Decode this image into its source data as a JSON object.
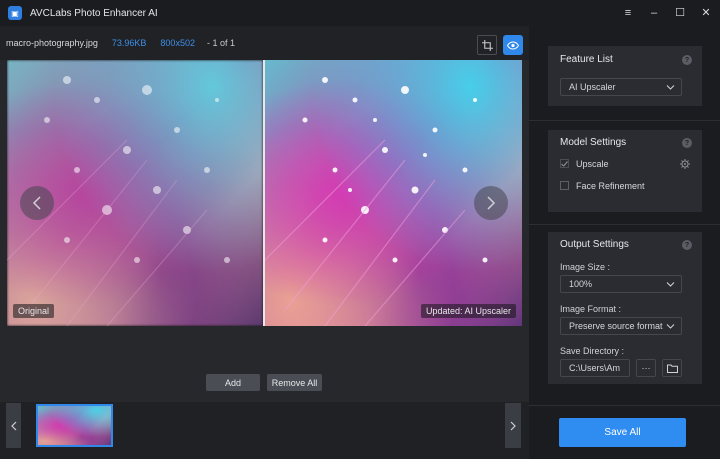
{
  "app": {
    "title": "AVCLabs Photo Enhancer AI"
  },
  "file": {
    "name": "macro-photography.jpg",
    "size": "73.96KB",
    "dimensions": "800x502",
    "counter": "- 1 of 1"
  },
  "preview": {
    "left_label": "Original",
    "right_label": "Updated: AI Upscaler"
  },
  "bottom": {
    "add_label": "Add",
    "remove_all_label": "Remove All"
  },
  "feature_list": {
    "title": "Feature List",
    "selected": "AI Upscaler"
  },
  "model_settings": {
    "title": "Model Settings",
    "options": [
      {
        "label": "Upscale",
        "checked": true
      },
      {
        "label": "Face Refinement",
        "checked": false
      }
    ]
  },
  "output_settings": {
    "title": "Output Settings",
    "image_size_label": "Image Size :",
    "image_size_value": "100%",
    "image_format_label": "Image Format :",
    "image_format_value": "Preserve source format",
    "save_directory_label": "Save Directory :",
    "save_directory_value": "C:\\Users\\Am",
    "more_label": "···"
  },
  "save_all_label": "Save All",
  "colors": {
    "accent": "#2f8cf0",
    "link": "#3d8fe8",
    "panel": "#2a2c31",
    "bg": "#1e2024"
  },
  "icons": [
    "app-logo-icon",
    "menu-icon",
    "minimize-icon",
    "maximize-icon",
    "close-icon",
    "crop-icon",
    "eye-icon",
    "prev-arrow-icon",
    "next-arrow-icon",
    "compare-icon",
    "split-icon",
    "fit-icon",
    "zoom-in-icon",
    "zoom-out-icon",
    "crop-tool-icon",
    "save-icon",
    "delete-icon",
    "undo-icon",
    "redo-icon",
    "rotate-icon",
    "help-icon",
    "gear-icon",
    "folder-icon",
    "chevron-down-icon"
  ]
}
